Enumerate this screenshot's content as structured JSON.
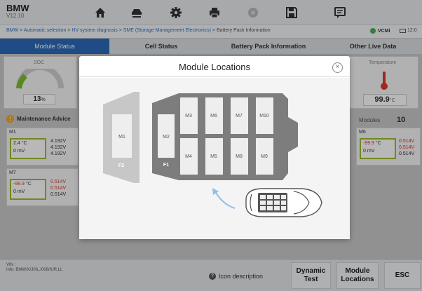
{
  "app": {
    "brand": "BMW",
    "version": "V12.10"
  },
  "toolbar": {
    "buttons": [
      {
        "name": "home-button",
        "icon": "home-icon"
      },
      {
        "name": "vehicle-button",
        "icon": "car-lift-icon"
      },
      {
        "name": "settings-button",
        "icon": "gear-icon"
      },
      {
        "name": "print-button",
        "icon": "printer-icon"
      },
      {
        "name": "stop-button",
        "icon": "stop-icon"
      },
      {
        "name": "save-button",
        "icon": "save-icon"
      },
      {
        "name": "message-button",
        "icon": "chat-icon"
      }
    ]
  },
  "breadcrumb": {
    "parts": [
      "BMW",
      "Automatic selection",
      "HV system diagnosis",
      "SME (Storage Management Electronics)",
      "Battery Pack Information"
    ],
    "separator": " > "
  },
  "status": {
    "vci_label": "VCMi",
    "time": "12:0"
  },
  "tabs": [
    {
      "label": "Module Status",
      "active": true
    },
    {
      "label": "Cell Status",
      "active": false
    },
    {
      "label": "Battery Pack Information",
      "active": false
    },
    {
      "label": "Other Live Data",
      "active": false
    }
  ],
  "dashboard": {
    "soc_label": "SOC",
    "soc_value": "13",
    "soc_unit": "%",
    "temperature_label": "Temperature",
    "temperature_value": "99.9",
    "temperature_unit": "°C",
    "maintenance_label": "Maintenance Advice",
    "modules_label": "Modules",
    "modules_count": "10"
  },
  "module_cards": [
    {
      "name": "M1",
      "temp": "2.4",
      "temp_unit": "°C",
      "current": "0",
      "current_unit": "mV",
      "voltages": [
        "4.192V",
        "4.192V",
        "4.192V"
      ],
      "alert": false
    },
    {
      "name": "M7",
      "temp": "-99.9",
      "temp_unit": "°C",
      "current": "0",
      "current_unit": "mV",
      "voltages": [
        "0.514V",
        "0.514V",
        "0.514V"
      ],
      "alert": true
    },
    {
      "name": "M6",
      "temp": "-99.9",
      "temp_unit": "°C",
      "current": "0",
      "current_unit": "mV",
      "voltages": [
        "0.514V",
        "0.514V",
        "0.514V"
      ],
      "alert": true
    }
  ],
  "vehicle_info": {
    "vin_label": "VIN :",
    "info_line": "Info: BMW/X/J0IL./008/IUR.LL"
  },
  "footer": {
    "icon_description": "Icon description",
    "buttons": [
      {
        "label_line1": "Dynamic",
        "label_line2": "Test"
      },
      {
        "label_line1": "Module",
        "label_line2": "Locations"
      },
      {
        "label_line1": "ESC",
        "label_line2": ""
      }
    ]
  },
  "modal": {
    "title": "Module Locations",
    "modules_top": [
      "M3",
      "M6",
      "M7",
      "M10"
    ],
    "modules_bottom": [
      "M4",
      "M5",
      "M8",
      "M9"
    ],
    "module_m1": "M1",
    "module_m2": "M2",
    "floor_f1": "F1",
    "floor_f2": "F2"
  },
  "colors": {
    "accent": "#2c6ab7",
    "battery_border": "#9bbd2a",
    "alert": "#d93a2b",
    "warning": "#f0a51f"
  }
}
